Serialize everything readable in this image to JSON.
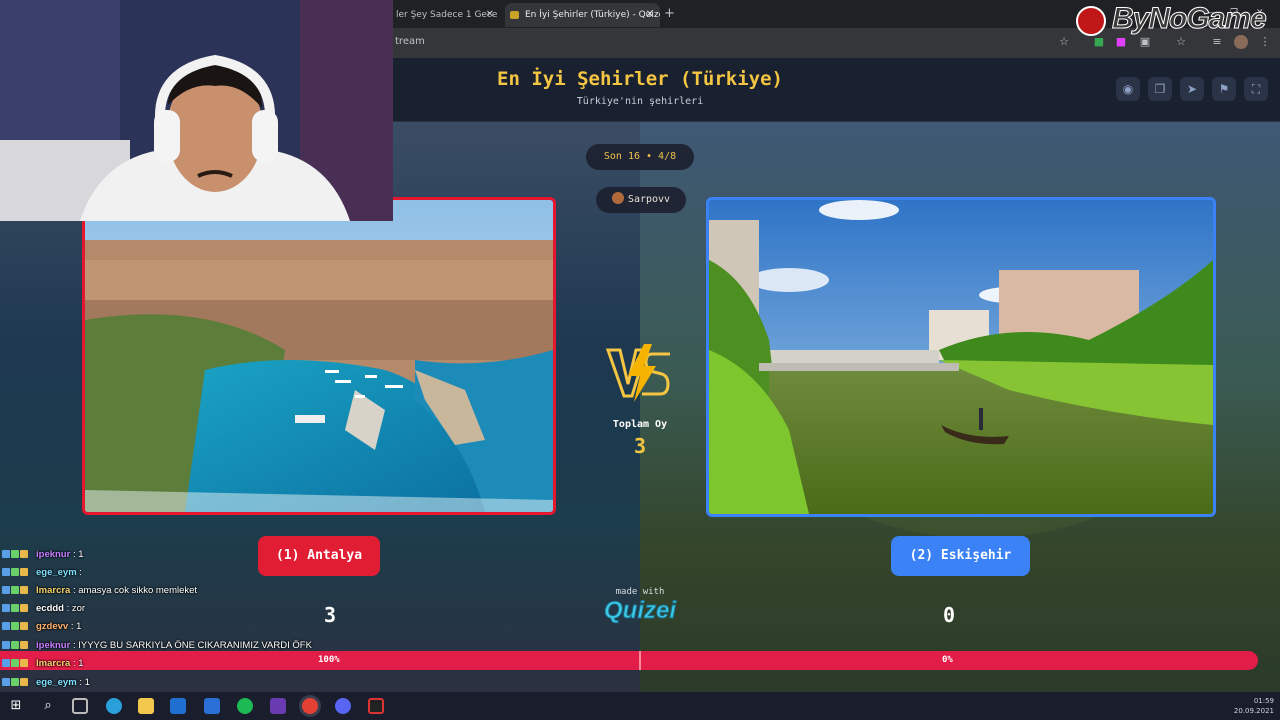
{
  "browser": {
    "tabs": [
      {
        "label": "ler Şey Sadece 1 Gece |"
      },
      {
        "label": "En İyi Şehirler (Türkiye) - Quizei"
      }
    ],
    "new_tab": "+",
    "url": "tream"
  },
  "overlay_logo": "ByNoGame",
  "quiz": {
    "title": "En İyi Şehirler (Türkiye)",
    "subtitle": "Türkiye'nin şehirleri",
    "round": "Son 16 • 4/8",
    "user": "Sarpovv",
    "total_label": "Toplam Oy",
    "total_votes": "3",
    "option_a": {
      "label": "(1) Antalya",
      "votes": "3",
      "percent": "100%",
      "share": 1.0
    },
    "option_b": {
      "label": "(2) Eskişehir",
      "votes": "0",
      "percent": "0%"
    },
    "made_with": "made with",
    "brand": "Quizei",
    "colors": {
      "red": "#e11d34",
      "blue": "#3b82f6",
      "gold": "#f4c542"
    }
  },
  "header_icons": [
    "eye-icon",
    "copy-icon",
    "send-icon",
    "flag-icon",
    "fullscreen-icon"
  ],
  "chat": [
    {
      "user": "ipeknur",
      "text": " : 1",
      "color": "#c77dff"
    },
    {
      "user": "ege_eym",
      "text": " : ",
      "color": "#7ee0ff"
    },
    {
      "user": "lmarcra",
      "text": " : amasya cok sikko memleket",
      "color": "#f6d36b"
    },
    {
      "user": "ecddd",
      "text": " : zor",
      "color": "#ffffff"
    },
    {
      "user": "gzdevv",
      "text": " : 1",
      "color": "#ffb36b"
    },
    {
      "user": "ipeknur",
      "text": " : IYYYG BU SARKIYLA ÖNE CIKARANIMIZ VARDI ÖFK",
      "color": "#c77dff"
    },
    {
      "user": "lmarcra",
      "text": " : 1",
      "color": "#f6d36b"
    },
    {
      "user": "ege_eym",
      "text": " : 1",
      "color": "#7ee0ff"
    }
  ],
  "clock": {
    "time": "01:59",
    "date": "20.09.2021"
  }
}
